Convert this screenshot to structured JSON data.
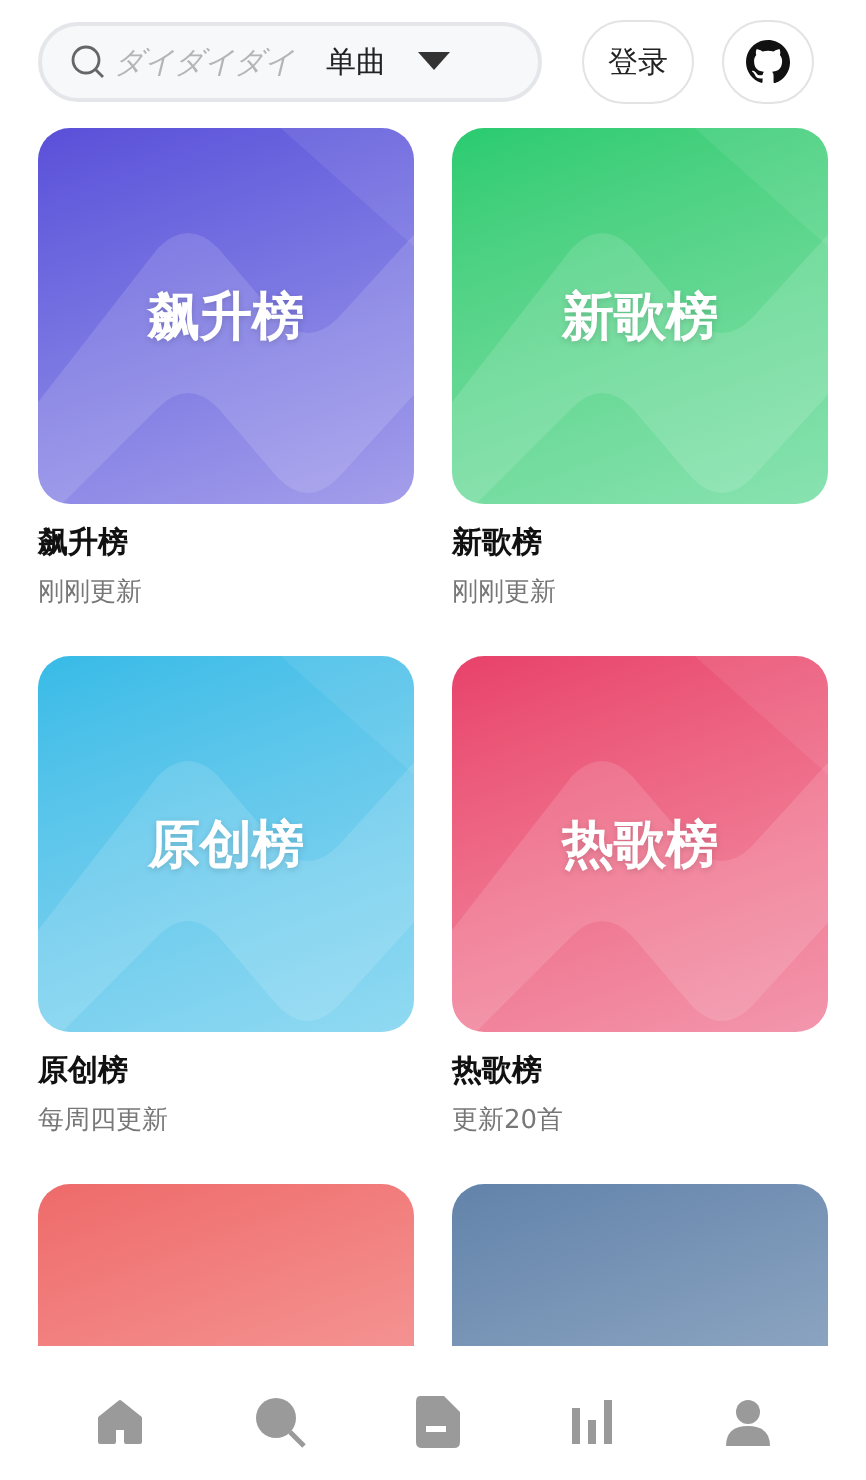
{
  "search": {
    "placeholder": "ダイダイダイ",
    "type_label": "单曲"
  },
  "login_button": "登录",
  "charts": [
    {
      "cover_text": "飙升榜",
      "title": "飙升榜",
      "subtitle": "刚刚更新",
      "color": "#5a4fd9"
    },
    {
      "cover_text": "新歌榜",
      "title": "新歌榜",
      "subtitle": "刚刚更新",
      "color": "#28cb70"
    },
    {
      "cover_text": "原创榜",
      "title": "原创榜",
      "subtitle": "每周四更新",
      "color": "#36bbe7"
    },
    {
      "cover_text": "热歌榜",
      "title": "热歌榜",
      "subtitle": "更新20首",
      "color": "#e8416a"
    },
    {
      "color": "#ee6a6a"
    },
    {
      "color": "#6283aa"
    }
  ],
  "nav": [
    {
      "kind": "home"
    },
    {
      "kind": "search"
    },
    {
      "kind": "document"
    },
    {
      "kind": "chart"
    },
    {
      "kind": "person"
    }
  ]
}
